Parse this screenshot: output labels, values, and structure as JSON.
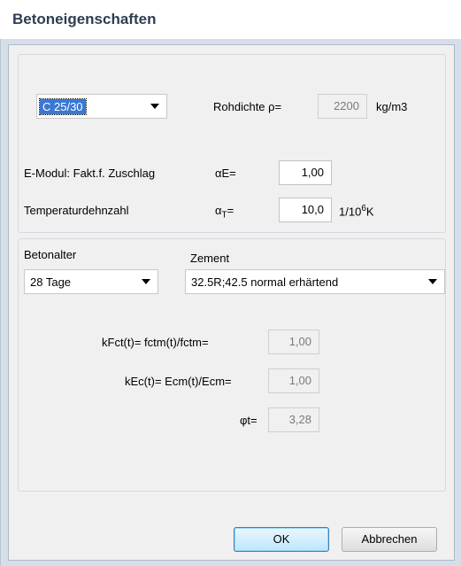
{
  "window": {
    "title": "Betoneigenschaften"
  },
  "top": {
    "concrete_class": "C 25/30",
    "rohdichte_label": "Rohdichte ρ=",
    "rohdichte_value": "2200",
    "rohdichte_unit": "kg/m3",
    "emodul_label": "E-Modul: Fakt.f. Zuschlag",
    "emodul_symbol": "αE=",
    "emodul_value": "1,00",
    "temp_label": "Temperaturdehnzahl",
    "temp_symbol_base": "α",
    "temp_symbol_sub": "T",
    "temp_symbol_eq": "=",
    "temp_value": "10,0",
    "temp_unit_base": "1/10",
    "temp_unit_sup": "6",
    "temp_unit_k": "K"
  },
  "bottom": {
    "betonalter_label": "Betonalter",
    "betonalter_value": "28 Tage",
    "zement_label": "Zement",
    "zement_value": "32.5R;42.5  normal erhärtend",
    "kfct_label": "kFct(t)= fctm(t)/fctm=",
    "kfct_value": "1,00",
    "kec_label": "kEc(t)= Ecm(t)/Ecm=",
    "kec_value": "1,00",
    "phi_label": "φt=",
    "phi_value": "3,28"
  },
  "buttons": {
    "ok": "OK",
    "cancel": "Abbrechen"
  },
  "colors": {
    "accent": "#3a78d4",
    "frame": "#d6dfe9",
    "client": "#f0f0f0"
  }
}
